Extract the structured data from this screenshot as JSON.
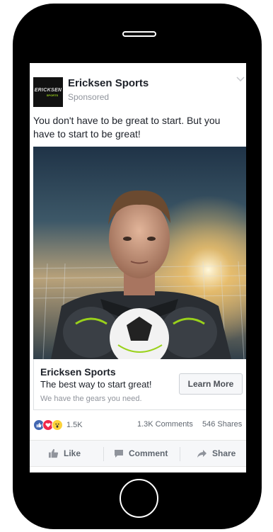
{
  "post": {
    "page_name": "Ericksen Sports",
    "sponsored_label": "Sponsored",
    "logo_text": "ERICKSEN",
    "logo_subtext": "SPORTS",
    "text": "You don't have to be great to start. But you have to start to be great!"
  },
  "cta": {
    "title": "Ericksen Sports",
    "headline": "The best way to start great!",
    "description": "We have the gears you need.",
    "button_label": "Learn More"
  },
  "stats": {
    "reaction_count": "1.5K",
    "comments": "1.3K Comments",
    "shares": "546 Shares"
  },
  "actions": {
    "like": "Like",
    "comment": "Comment",
    "share": "Share"
  },
  "colors": {
    "like_blue": "#4267b2",
    "love_red": "#f0284a",
    "wow_yellow": "#fcd23a",
    "accent_green": "#9ad21b"
  }
}
